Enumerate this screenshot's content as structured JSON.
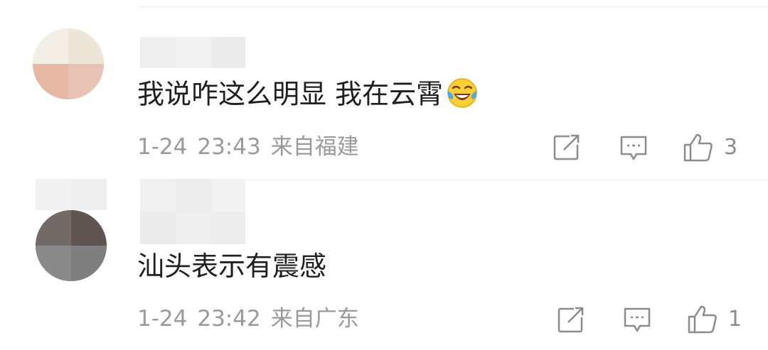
{
  "comments": [
    {
      "text": "我说咋这么明显 我在云霄",
      "emoji": "laughing-crying-emoji",
      "date": "1-24",
      "time": "23:43",
      "location": "来自福建",
      "likes": "3"
    },
    {
      "text": "汕头表示有震感",
      "date": "1-24",
      "time": "23:42",
      "location": "来自广东",
      "likes": "1"
    }
  ],
  "icons": {
    "share": "share-icon",
    "reply": "comment-icon",
    "like": "thumbs-up-icon"
  },
  "colors": {
    "text": "#1f1f1f",
    "meta": "#9a9a9a",
    "icon": "#8c8c8c",
    "divider": "#ececec"
  }
}
